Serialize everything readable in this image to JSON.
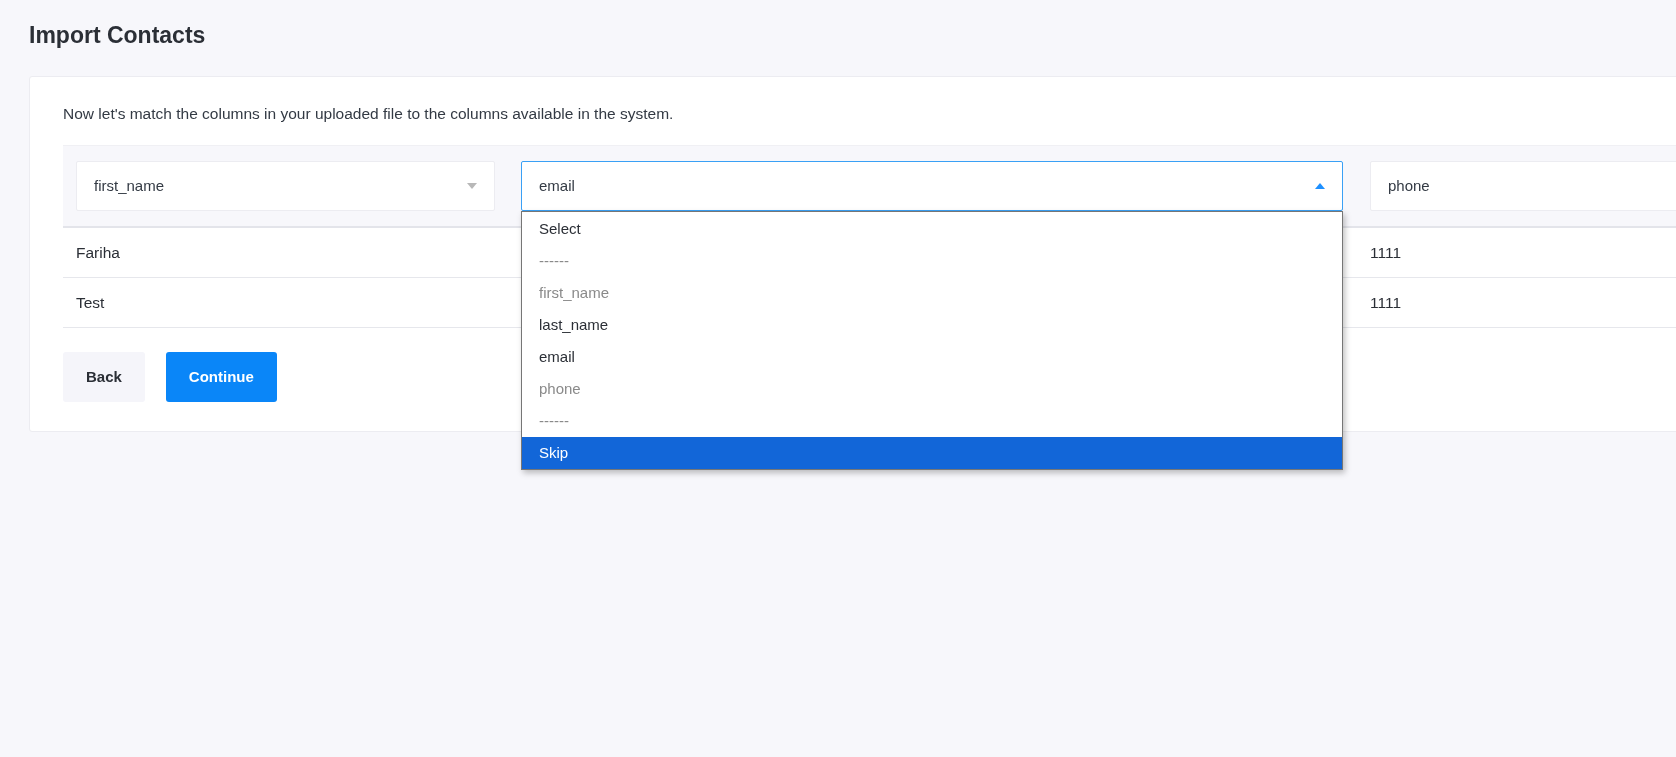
{
  "title": "Import Contacts",
  "intro": "Now let's match the columns in your uploaded file to the columns available in the system.",
  "columns": [
    {
      "value": "first_name",
      "open": false
    },
    {
      "value": "email",
      "open": true,
      "options": [
        {
          "label": "Select",
          "disabled": false,
          "highlighted": false
        },
        {
          "label": "------",
          "disabled": true,
          "highlighted": false
        },
        {
          "label": "first_name",
          "disabled": true,
          "highlighted": false
        },
        {
          "label": "last_name",
          "disabled": false,
          "highlighted": false
        },
        {
          "label": "email",
          "disabled": false,
          "highlighted": false
        },
        {
          "label": "phone",
          "disabled": true,
          "highlighted": false
        },
        {
          "label": "------",
          "disabled": true,
          "highlighted": false
        },
        {
          "label": "Skip",
          "disabled": false,
          "highlighted": true
        }
      ]
    },
    {
      "value": "phone",
      "open": false
    }
  ],
  "rows": [
    {
      "column_1": "Fariha",
      "column_3": "1111"
    },
    {
      "column_1": "Test",
      "column_3": "1111"
    }
  ],
  "buttons": [
    {
      "label": "Back",
      "kind": "secondary"
    },
    {
      "label": "Continue",
      "kind": "primary"
    }
  ]
}
